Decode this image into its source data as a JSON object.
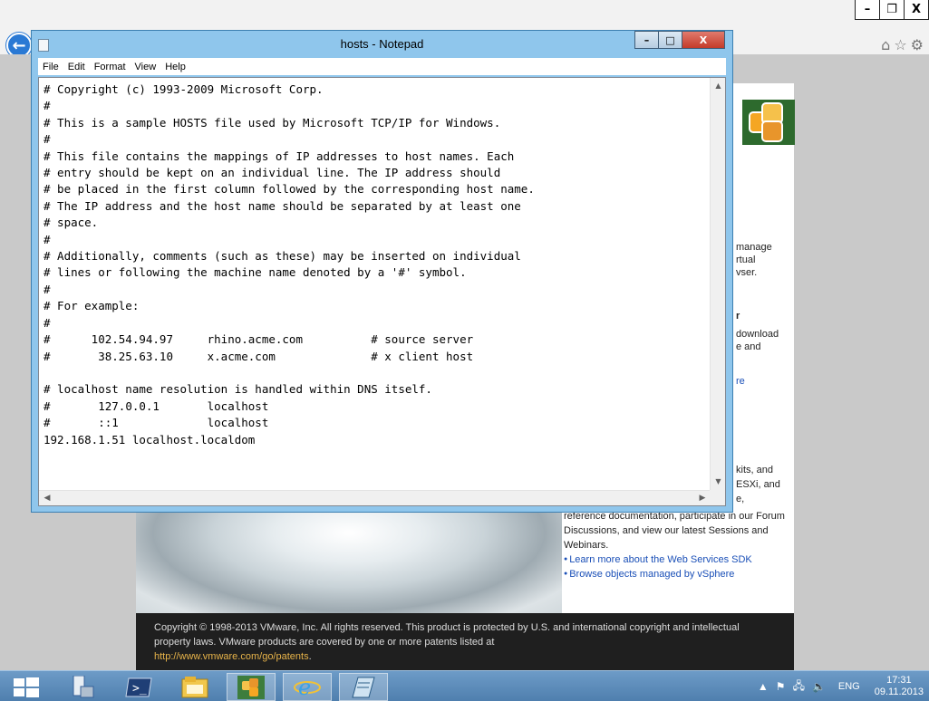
{
  "browser": {
    "window_controls": [
      "–",
      "❐",
      "X"
    ],
    "toolbar_icons": [
      "home-icon",
      "star-icon",
      "gear-icon"
    ]
  },
  "notepad": {
    "title": "hosts - Notepad",
    "menu": [
      "File",
      "Edit",
      "Format",
      "View",
      "Help"
    ],
    "content": "# Copyright (c) 1993-2009 Microsoft Corp.\n#\n# This is a sample HOSTS file used by Microsoft TCP/IP for Windows.\n#\n# This file contains the mappings of IP addresses to host names. Each\n# entry should be kept on an individual line. The IP address should\n# be placed in the first column followed by the corresponding host name.\n# The IP address and the host name should be separated by at least one\n# space.\n#\n# Additionally, comments (such as these) may be inserted on individual\n# lines or following the machine name denoted by a '#' symbol.\n#\n# For example:\n#\n#      102.54.94.97     rhino.acme.com          # source server\n#       38.25.63.10     x.acme.com              # x client host\n\n# localhost name resolution is handled within DNS itself.\n#\t127.0.0.1       localhost\n#\t::1             localhost\n192.168.1.51 localhost.localdom"
  },
  "webpage": {
    "fragments": {
      "manage": "manage",
      "rtual": "rtual",
      "vser": "vser.",
      "r": "r",
      "download": "download",
      "and": "e and",
      "re": "re",
      "kits": "kits, and",
      "esxi": "ESXi, and",
      "e": "e,"
    },
    "body_text": "reference documentation, participate in our Forum Discussions, and view our latest Sessions and Webinars.",
    "links": [
      "Learn more about the Web Services SDK",
      "Browse objects managed by vSphere"
    ],
    "footer_text": "Copyright © 1998-2013 VMware, Inc. All rights reserved. This product is protected by U.S. and international copyright and intellectual property laws. VMware products are covered by one or more patents listed at",
    "footer_link": "http://www.vmware.com/go/patents"
  },
  "taskbar": {
    "items": [
      "start-icon",
      "server-manager-icon",
      "powershell-icon",
      "file-explorer-icon",
      "vsphere-client-icon",
      "internet-explorer-icon",
      "notepad-icon"
    ],
    "language": "ENG",
    "time": "17:31",
    "date": "09.11.2013"
  },
  "colors": {
    "taskbar": "#5a89b8",
    "notepad_frame": "#8fc6ec",
    "close_button": "#c43b2a",
    "link": "#1a4fb7",
    "footer_link": "#e8b44a"
  }
}
